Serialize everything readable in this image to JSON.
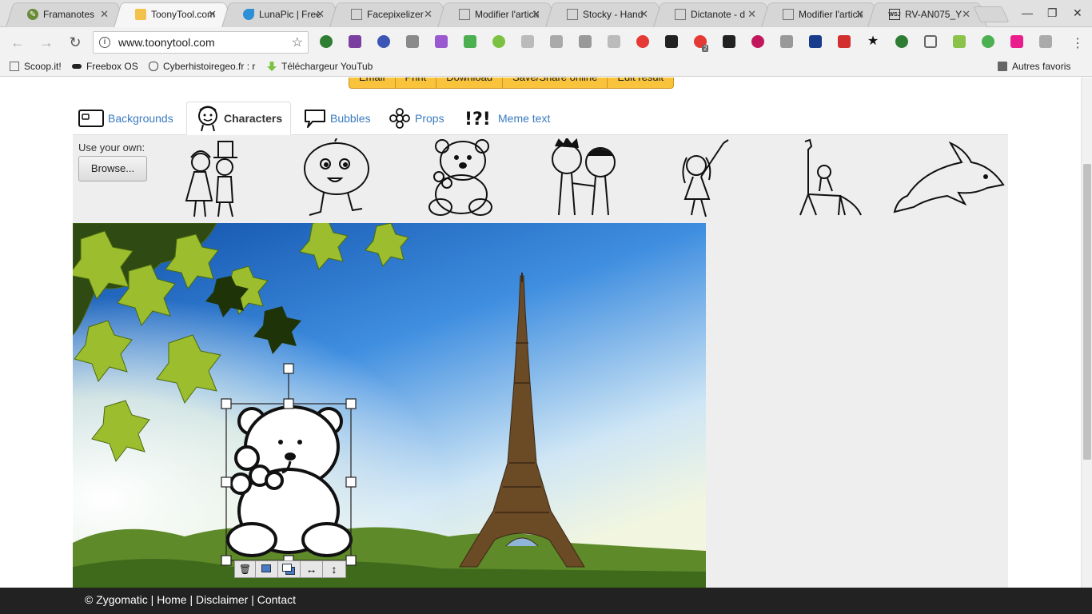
{
  "browser": {
    "tabs": [
      {
        "title": "Framanotes",
        "active": false
      },
      {
        "title": "ToonyTool.com",
        "active": true
      },
      {
        "title": "LunaPic | Free",
        "active": false
      },
      {
        "title": "Facepixelizer",
        "active": false
      },
      {
        "title": "Modifier l'article",
        "active": false
      },
      {
        "title": "Stocky - Hand",
        "active": false
      },
      {
        "title": "Dictanote - d",
        "active": false
      },
      {
        "title": "Modifier l'article",
        "active": false
      },
      {
        "title": "RV-AN075_Y",
        "active": false
      }
    ],
    "url": "www.toonytool.com",
    "bookmarks": [
      {
        "label": "Scoop.it!"
      },
      {
        "label": "Freebox OS"
      },
      {
        "label": "Cyberhistoiregeo.fr : r"
      },
      {
        "label": "Téléchargeur YouTub"
      },
      {
        "label": "Autres favoris"
      }
    ],
    "ext_badge": "2"
  },
  "actions": [
    "Email",
    "Print",
    "Download",
    "Save/Share online",
    "Edit result"
  ],
  "category_tabs": [
    {
      "label": "Backgrounds",
      "active": false
    },
    {
      "label": "Characters",
      "active": true
    },
    {
      "label": "Bubbles",
      "active": false
    },
    {
      "label": "Props",
      "active": false
    },
    {
      "label": "Meme text",
      "active": false
    }
  ],
  "panel": {
    "use_own_label": "Use your own:",
    "browse_label": "Browse..."
  },
  "character_thumbnails": [
    "wedding-couple-icon",
    "baby-icon",
    "teddy-bear-icon",
    "two-boys-icon",
    "girl-waving-icon",
    "giraffe-and-kid-icon",
    "dolphin-icon"
  ],
  "canvas": {
    "background": "eiffel-tower-scene",
    "selected_character": "teddy-bear-with-flowers"
  },
  "footer": {
    "copyright": "© Zygomatic",
    "links": [
      "Home",
      "Disclaimer",
      "Contact"
    ],
    "separator": " | "
  },
  "colors": {
    "accent_yellow": "#f9c33c",
    "link_blue": "#3a7bbf",
    "footer_bg": "#222222"
  }
}
